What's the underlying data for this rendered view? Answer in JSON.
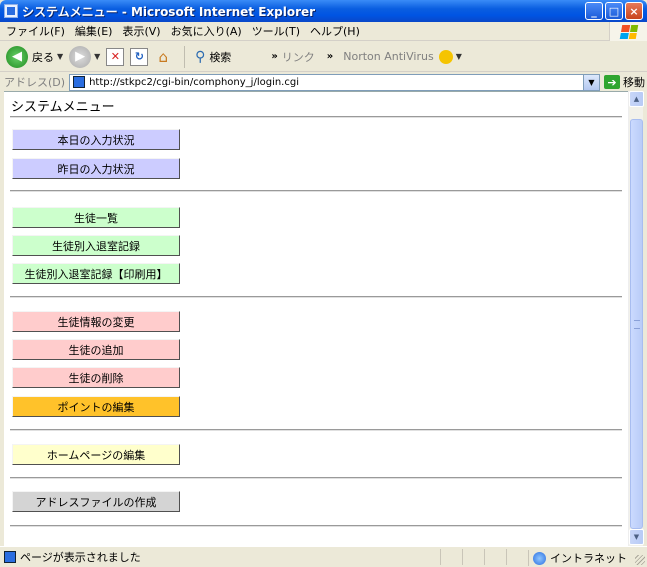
{
  "window": {
    "title": "システムメニュー - Microsoft Internet Explorer",
    "min_label": "_",
    "max_label": "□",
    "close_label": "×"
  },
  "menubar": {
    "items": [
      {
        "label": "ファイル(F)"
      },
      {
        "label": "編集(E)"
      },
      {
        "label": "表示(V)"
      },
      {
        "label": "お気に入り(A)"
      },
      {
        "label": "ツール(T)"
      },
      {
        "label": "ヘルプ(H)"
      }
    ]
  },
  "toolbar": {
    "back_label": "戻る",
    "search_label": "検索",
    "links_label": "リンク",
    "norton_label": "Norton AntiVirus",
    "more_label": "»"
  },
  "address": {
    "label": "アドレス(D)",
    "url": "http://stkpc2/cgi-bin/comphony_j/login.cgi",
    "go_label": "移動"
  },
  "page": {
    "title": "システムメニュー",
    "buttons": {
      "today_entry": "本日の入力状況",
      "yesterday_entry": "昨日の入力状況",
      "student_list": "生徒一覧",
      "student_attendance": "生徒別入退室記録",
      "student_attendance_print": "生徒別入退室記録【印刷用】",
      "change_student_info": "生徒情報の変更",
      "add_student": "生徒の追加",
      "delete_student": "生徒の削除",
      "edit_points": "ポイントの編集",
      "edit_homepage": "ホームページの編集",
      "create_address_file": "アドレスファイルの作成"
    }
  },
  "status": {
    "text": "ページが表示されました",
    "zone": "イントラネット"
  },
  "colors": {
    "blue_button": "#ccccff",
    "green_button": "#ccffcc",
    "pink_button": "#ffcccc",
    "orange_button": "#ffc22a",
    "yellow_button": "#ffffcc",
    "gray_button": "#d4d4d4"
  }
}
